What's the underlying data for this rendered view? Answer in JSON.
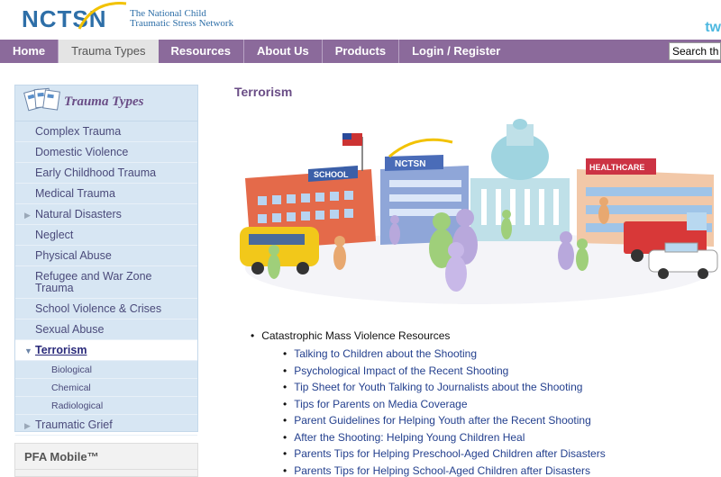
{
  "header": {
    "logo": "NCTSN",
    "tagline_1": "The National Child",
    "tagline_2": "Traumatic Stress Network",
    "social_fragment": "tw"
  },
  "nav": {
    "items": [
      "Home",
      "Trauma Types",
      "Resources",
      "About Us",
      "Products",
      "Login / Register"
    ],
    "search_value": "Search th"
  },
  "sidebar": {
    "title": "Trauma Types",
    "items": [
      {
        "label": "Complex Trauma",
        "arrow": ""
      },
      {
        "label": "Domestic Violence",
        "arrow": ""
      },
      {
        "label": "Early Childhood Trauma",
        "arrow": ""
      },
      {
        "label": "Medical Trauma",
        "arrow": ""
      },
      {
        "label": "Natural Disasters",
        "arrow": "▶"
      },
      {
        "label": "Neglect",
        "arrow": ""
      },
      {
        "label": "Physical Abuse",
        "arrow": ""
      },
      {
        "label": "Refugee and War Zone Trauma",
        "arrow": ""
      },
      {
        "label": "School Violence & Crises",
        "arrow": ""
      },
      {
        "label": "Sexual Abuse",
        "arrow": ""
      },
      {
        "label": "Terrorism",
        "arrow": "▼"
      }
    ],
    "subitems": [
      "Biological",
      "Chemical",
      "Radiological"
    ],
    "last_item": {
      "label": "Traumatic Grief",
      "arrow": "▶"
    }
  },
  "pfa": {
    "title": "PFA Mobile™"
  },
  "main": {
    "title": "Terrorism",
    "image_labels": {
      "school": "SCHOOL",
      "nctsn": "NCTSN",
      "healthcare": "HEALTHCARE"
    },
    "resources_heading": "Catastrophic Mass Violence Resources",
    "resources": [
      "Talking to Children about the Shooting",
      "Psychological Impact of the Recent Shooting",
      "Tip Sheet for Youth Talking to Journalists about the Shooting",
      "Tips for Parents on Media Coverage",
      "Parent Guidelines for Helping Youth after the Recent Shooting",
      "After the Shooting: Helping Young Children Heal",
      "Parents Tips for Helping Preschool-Aged Children after Disasters",
      "Parents Tips for Helping School-Aged Children after Disasters"
    ]
  },
  "colors": {
    "nav_bg": "#8b6a9b",
    "sidebar_bg": "#d7e6f3",
    "title_purple": "#6a4d86",
    "link_blue": "#24408e",
    "logo_blue": "#2e6fa8"
  }
}
